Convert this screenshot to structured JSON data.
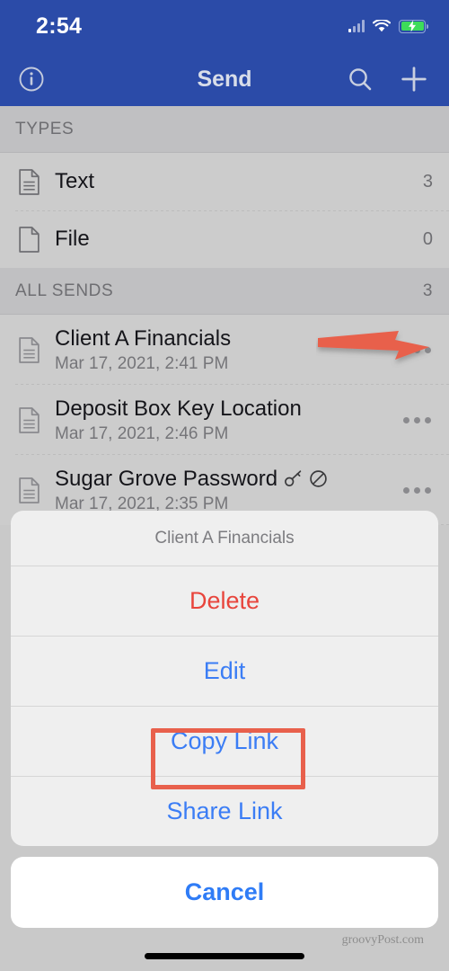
{
  "status_bar": {
    "time": "2:54",
    "signal_icon": "cellular-signal-icon",
    "wifi_icon": "wifi-icon",
    "battery_icon": "battery-charging-icon"
  },
  "nav_bar": {
    "title": "Send",
    "info_icon": "info-circle-icon",
    "search_icon": "search-icon",
    "add_icon": "plus-icon",
    "accent_color": "#2b4ba8"
  },
  "types_section": {
    "header": "TYPES",
    "items": [
      {
        "label": "Text",
        "count": "3",
        "icon": "text-document-icon"
      },
      {
        "label": "File",
        "count": "0",
        "icon": "file-document-icon"
      }
    ]
  },
  "all_sends_section": {
    "header": "ALL SENDS",
    "count": "3",
    "items": [
      {
        "title": "Client A Financials",
        "date": "Mar 17, 2021, 2:41 PM",
        "icon": "text-document-icon",
        "has_password": false,
        "is_disabled": false
      },
      {
        "title": "Deposit Box Key Location",
        "date": "Mar 17, 2021, 2:46 PM",
        "icon": "text-document-icon",
        "has_password": false,
        "is_disabled": false
      },
      {
        "title": "Sugar Grove Password",
        "date": "Mar 17, 2021, 2:35 PM",
        "icon": "text-document-icon",
        "has_password": true,
        "is_disabled": true
      }
    ],
    "options_icon": "more-options-icon"
  },
  "action_sheet": {
    "title": "Client A Financials",
    "items": [
      {
        "label": "Delete",
        "style": "destructive"
      },
      {
        "label": "Edit",
        "style": "normal"
      },
      {
        "label": "Copy Link",
        "style": "normal"
      },
      {
        "label": "Share Link",
        "style": "normal"
      }
    ],
    "cancel_label": "Cancel",
    "destructive_color": "#e8453c",
    "normal_color": "#3b7df5"
  },
  "annotations": {
    "arrow_target": "more-options-icon",
    "highlight_target": "Copy Link",
    "color": "#e8604c"
  },
  "footer": {
    "watermark": "groovyPost.com"
  }
}
